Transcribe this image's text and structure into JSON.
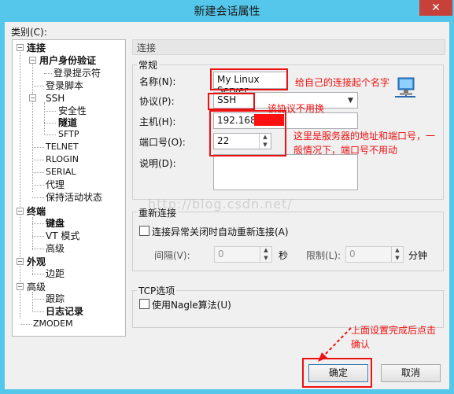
{
  "window": {
    "title": "新建会话属性",
    "close_glyph": "✕"
  },
  "category_label": "类别(C):",
  "tree": [
    {
      "label": "连接",
      "bold": true
    },
    {
      "label": "用户身份验证",
      "bold": true
    },
    {
      "label": "登录提示符",
      "bold": false
    },
    {
      "label": "登录脚本",
      "bold": false
    },
    {
      "label": "SSH",
      "bold": false
    },
    {
      "label": "安全性",
      "bold": false
    },
    {
      "label": "隧道",
      "bold": true
    },
    {
      "label": "SFTP",
      "bold": false
    },
    {
      "label": "TELNET",
      "bold": false
    },
    {
      "label": "RLOGIN",
      "bold": false
    },
    {
      "label": "SERIAL",
      "bold": false
    },
    {
      "label": "代理",
      "bold": false
    },
    {
      "label": "保持活动状态",
      "bold": false
    },
    {
      "label": "终端",
      "bold": true
    },
    {
      "label": "键盘",
      "bold": true
    },
    {
      "label": "VT 模式",
      "bold": false
    },
    {
      "label": "高级",
      "bold": false
    },
    {
      "label": "外观",
      "bold": true
    },
    {
      "label": "边距",
      "bold": false
    },
    {
      "label": "高级",
      "bold": false
    },
    {
      "label": "跟踪",
      "bold": false
    },
    {
      "label": "日志记录",
      "bold": true
    },
    {
      "label": "ZMODEM",
      "bold": false
    }
  ],
  "panel": {
    "header": "连接"
  },
  "general": {
    "group_label": "常规",
    "name_label": "名称(N):",
    "name_value": "My Linux Server",
    "protocol_label": "协议(P):",
    "protocol_value": "SSH",
    "host_label": "主机(H):",
    "host_value": "192.168.",
    "port_label": "端口号(O):",
    "port_value": "22",
    "desc_label": "说明(D):",
    "desc_value": ""
  },
  "reconnect": {
    "group_label": "重新连接",
    "checkbox_label": "连接异常关闭时自动重新连接(A)",
    "interval_label": "间隔(V):",
    "interval_value": "0",
    "interval_unit": "秒",
    "limit_label": "限制(L):",
    "limit_value": "0",
    "limit_unit": "分钟"
  },
  "tcp": {
    "group_label": "TCP选项",
    "checkbox_label": "使用Nagle算法(U)"
  },
  "buttons": {
    "ok": "确定",
    "cancel": "取消"
  },
  "annotations": {
    "name_note": "给自己的连接起个名字",
    "protocol_note": "该协议不用换",
    "host_note_line1": "这里是服务器的地址和端口号，一",
    "host_note_line2": "般情况下，端口号不用动",
    "ok_note_line1": "上面设置完成后点击",
    "ok_note_line2": "确认"
  },
  "watermark": "http://blog.csdn.net/",
  "colors": {
    "titlebar": "#55c7ea",
    "close": "#c7413a",
    "annotation": "#e11111",
    "redact": "#ff1010"
  }
}
